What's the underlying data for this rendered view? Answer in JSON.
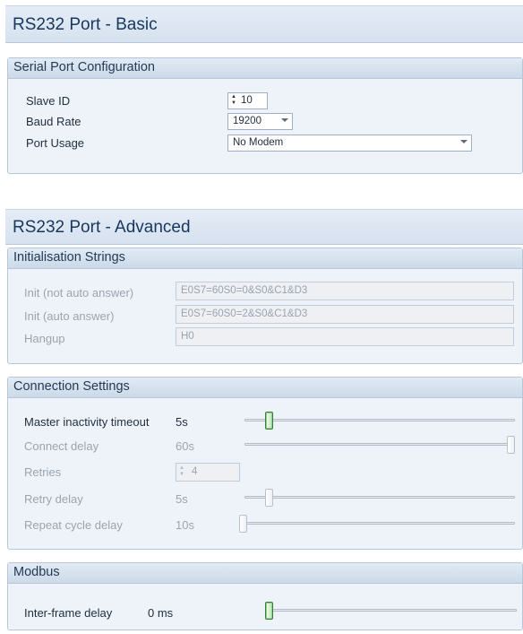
{
  "basic": {
    "title": "RS232 Port - Basic",
    "serial_port": {
      "title": "Serial Port Configuration",
      "slave_id": {
        "label": "Slave ID",
        "value": "10"
      },
      "baud_rate": {
        "label": "Baud Rate",
        "value": "19200"
      },
      "port_usage": {
        "label": "Port Usage",
        "value": "No Modem"
      }
    }
  },
  "advanced": {
    "title": "RS232 Port - Advanced",
    "init_strings": {
      "title": "Initialisation Strings",
      "init_not_auto": {
        "label": "Init (not auto answer)",
        "value": "E0S7=60S0=0&S0&C1&D3"
      },
      "init_auto": {
        "label": "Init (auto answer)",
        "value": "E0S7=60S0=2&S0&C1&D3"
      },
      "hangup": {
        "label": "Hangup",
        "value": "H0"
      }
    },
    "connection": {
      "title": "Connection Settings",
      "master_inactivity": {
        "label": "Master inactivity timeout",
        "value": "5s",
        "slider_fraction": 0.08
      },
      "connect_delay": {
        "label": "Connect delay",
        "value": "60s",
        "slider_fraction": 1.0
      },
      "retries": {
        "label": "Retries",
        "value": "4"
      },
      "retry_delay": {
        "label": "Retry delay",
        "value": "5s",
        "slider_fraction": 0.08
      },
      "repeat_cycle": {
        "label": "Repeat cycle delay",
        "value": "10s",
        "slider_fraction": 0.0
      }
    },
    "modbus": {
      "title": "Modbus",
      "inter_frame": {
        "label": "Inter-frame delay",
        "value": "0 ms",
        "slider_fraction": 0.0
      }
    }
  },
  "colors": {
    "header_text": "#17375e",
    "disabled_text": "#9aa4b0",
    "active_thumb": "#3b7a3b"
  }
}
